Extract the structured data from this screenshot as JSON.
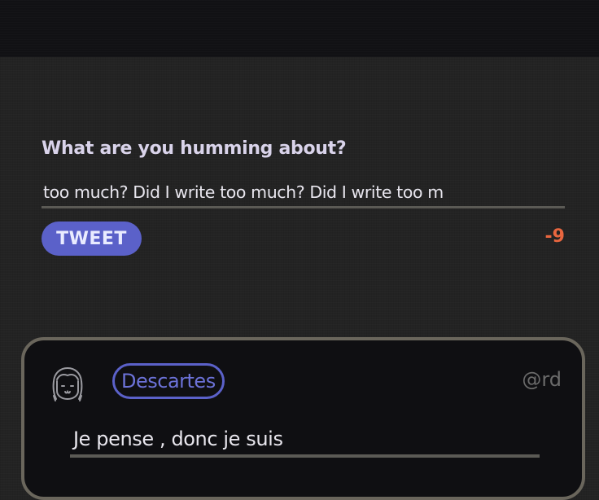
{
  "composer": {
    "label": "What are you humming about?",
    "input_value": "too much? Did I write too much? Did I write too m",
    "tweet_button_label": "TWEET",
    "char_count": "-9"
  },
  "feed": {
    "cards": [
      {
        "author": "Descartes",
        "handle": "@rd",
        "text": "Je pense , donc je suis",
        "avatar_icon": "girl-face-icon"
      }
    ]
  },
  "colors": {
    "accent": "#5b61c9",
    "warning": "#e9663f",
    "background": "#232323",
    "topbar": "#111114"
  }
}
